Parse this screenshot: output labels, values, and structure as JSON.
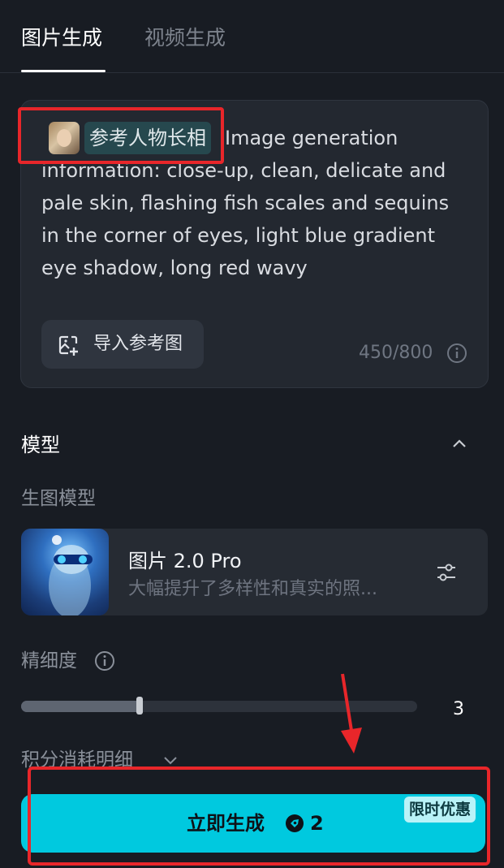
{
  "tabs": [
    {
      "label": "图片生成",
      "active": true
    },
    {
      "label": "视频生成",
      "active": false
    }
  ],
  "prompt": {
    "reference_tag": "参考人物长相",
    "text": "Image generation information: close-up, clean, delicate and pale skin, flashing fish scales and sequins in the corner of eyes, light blue gradient eye shadow, long red wavy",
    "import_label": "导入参考图",
    "char_count": "450/800"
  },
  "model_section": {
    "title": "模型",
    "sub_label": "生图模型",
    "model_name": "图片 2.0 Pro",
    "model_desc": "大幅提升了多样性和真实的照..."
  },
  "detail": {
    "label": "精细度",
    "value": "3",
    "level_fraction": 0.3
  },
  "cost": {
    "label": "积分消耗明细"
  },
  "generate": {
    "label": "立即生成",
    "credits": "2",
    "promo": "限时优惠"
  },
  "colors": {
    "accent": "#00c9df",
    "background": "#181c23",
    "annotation": "#e8262a"
  },
  "icons": [
    "import-image-icon",
    "info-icon",
    "chevron-up-icon",
    "settings-sliders-icon",
    "chevron-down-icon",
    "credit-coin-icon"
  ]
}
